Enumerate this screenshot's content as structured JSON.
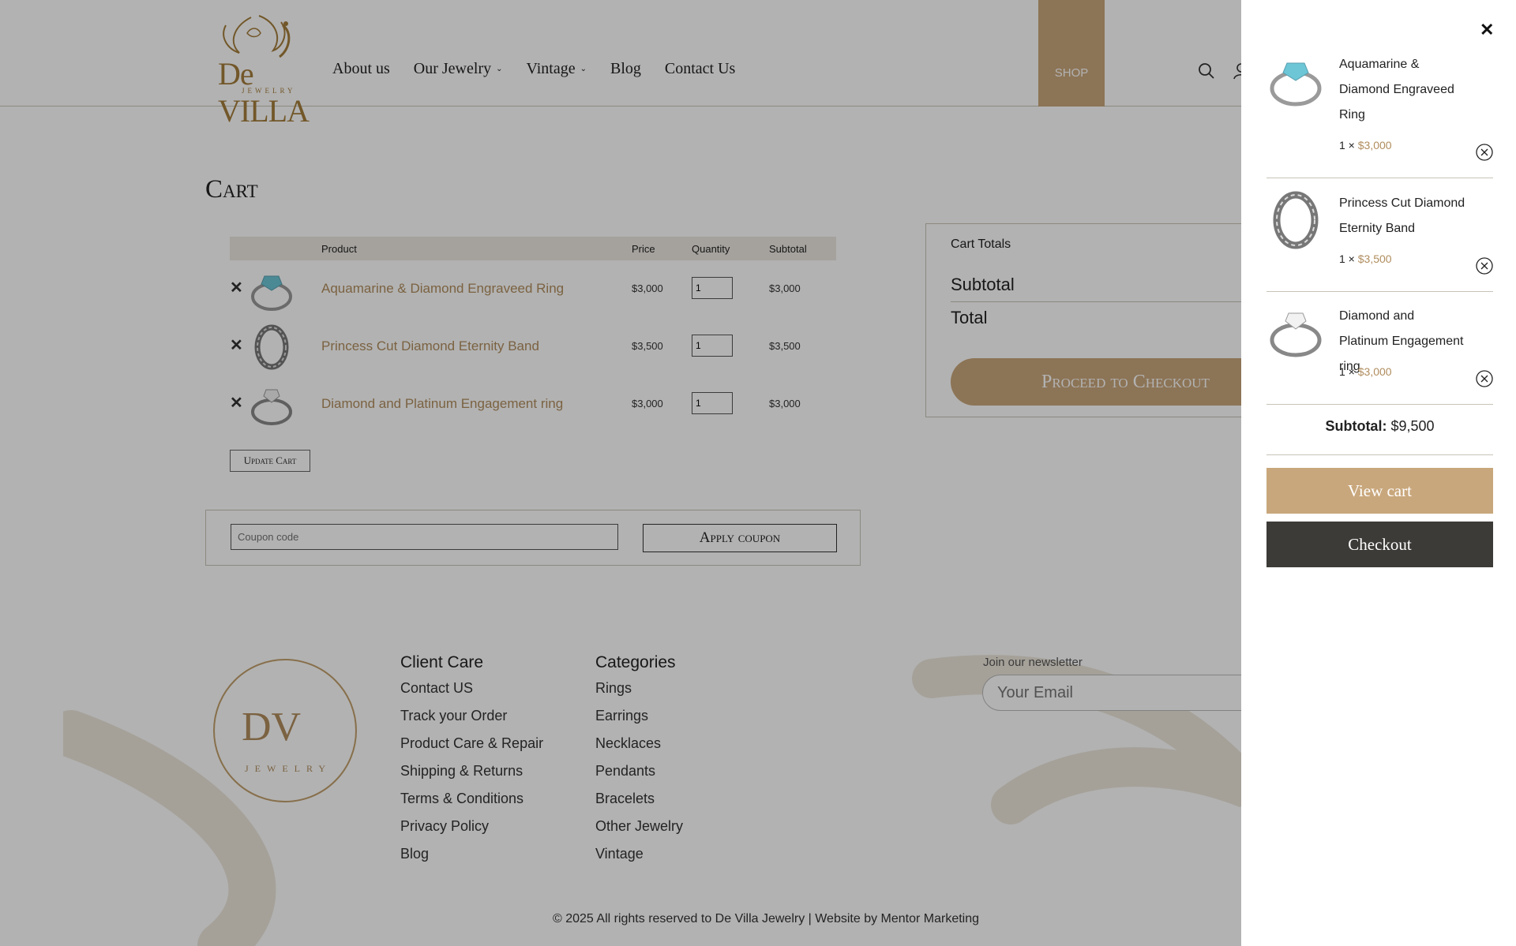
{
  "brand": {
    "logo_word": "De VILLA",
    "logo_sub": "JEWELRY",
    "footer_logo_mark": "DV",
    "footer_logo_sub": "JEWELRY"
  },
  "nav": {
    "items": [
      {
        "label": "About us"
      },
      {
        "label": "Our Jewelry"
      },
      {
        "label": "Vintage"
      },
      {
        "label": "Blog"
      },
      {
        "label": "Contact Us"
      }
    ],
    "shop_label": "SHOP",
    "icons": [
      "search-icon",
      "user-icon"
    ]
  },
  "cart": {
    "title": "Cart",
    "headers": {
      "product": "Product",
      "price": "Price",
      "quantity": "Quantity",
      "subtotal": "Subtotal"
    },
    "rows": [
      {
        "name": "Aquamarine & Diamond Engraveed Ring",
        "price": "$3,000",
        "qty": "1",
        "subtotal": "$3,000"
      },
      {
        "name": "Princess Cut Diamond Eternity Band",
        "price": "$3,500",
        "qty": "1",
        "subtotal": "$3,500"
      },
      {
        "name": "Diamond and Platinum Engagement ring",
        "price": "$3,000",
        "qty": "1",
        "subtotal": "$3,000"
      }
    ],
    "remove_glyph": "✕",
    "update_label": "Update Cart",
    "coupon_placeholder": "Coupon code",
    "apply_label": "Apply coupon"
  },
  "totals": {
    "title": "Cart Totals",
    "subtotal_label": "Subtotal",
    "subtotal_value": "$",
    "total_label": "Total",
    "total_value": "$",
    "checkout_label": "Proceed to Checkout"
  },
  "footer": {
    "client_care": {
      "heading": "Client Care",
      "links": [
        "Contact US",
        "Track your Order",
        "Product Care & Repair",
        "Shipping & Returns",
        "Terms & Conditions",
        "Privacy Policy",
        "Blog"
      ]
    },
    "categories": {
      "heading": "Categories",
      "links": [
        "Rings",
        "Earrings",
        "Necklaces",
        "Pendants",
        "Bracelets",
        "Other Jewelry",
        "Vintage"
      ]
    },
    "newsletter_label": "Join our newsletter",
    "email_placeholder": "Your Email",
    "copyright": "© 2025 All rights reserved to De Villa Jewelry | Website by Mentor Marketing"
  },
  "minicart": {
    "close_glyph": "✕",
    "items": [
      {
        "name": "Aquamarine & Diamond Engraveed Ring",
        "qty_prefix": "1 ×",
        "price": "$3,000"
      },
      {
        "name": "Princess Cut Diamond Eternity Band",
        "qty_prefix": "1 ×",
        "price": "$3,500"
      },
      {
        "name": "Diamond and Platinum Engagement ring",
        "qty_prefix": "1 ×",
        "price": "$3,000"
      }
    ],
    "subtotal_label": "Subtotal:",
    "subtotal_value": "$9,500",
    "view_cart_label": "View cart",
    "checkout_label": "Checkout"
  },
  "colors": {
    "gold": "#c9a77c",
    "gold_text": "#b08d5e",
    "dark_button": "#3d3b38",
    "border": "#c9c4b8"
  }
}
